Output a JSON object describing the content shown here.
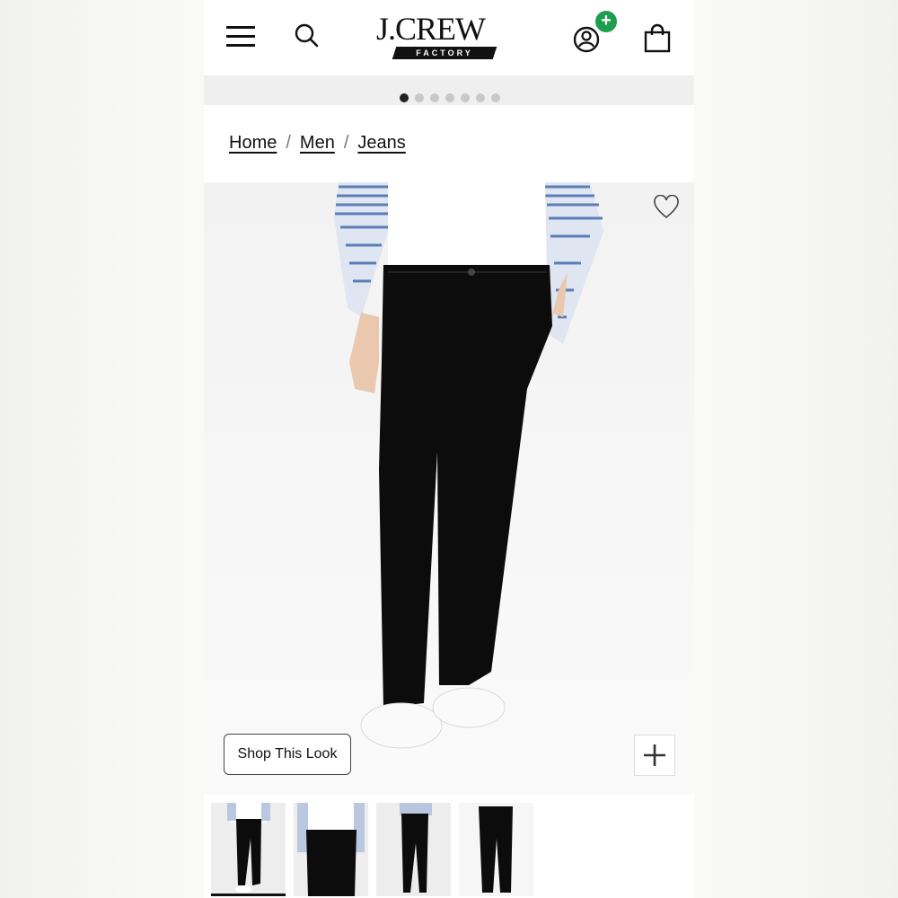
{
  "header": {
    "logo_main": "J.CREW",
    "logo_sub": "FACTORY"
  },
  "carousel": {
    "total_slides": 7,
    "active_index": 0
  },
  "breadcrumb": [
    {
      "label": "Home"
    },
    {
      "label": "Men"
    },
    {
      "label": "Jeans"
    }
  ],
  "product_image": {
    "shop_look_label": "Shop This Look"
  },
  "thumbnails": {
    "count": 4,
    "active_index": 0
  },
  "colors": {
    "accent_green": "#1e9e4c",
    "denim_black": "#0c0c0c",
    "shirt_stripe": "#5a7fb8"
  },
  "icons": [
    "menu-icon",
    "search-icon",
    "account-icon",
    "add-badge-icon",
    "shopping-bag-icon",
    "heart-icon",
    "plus-icon"
  ]
}
